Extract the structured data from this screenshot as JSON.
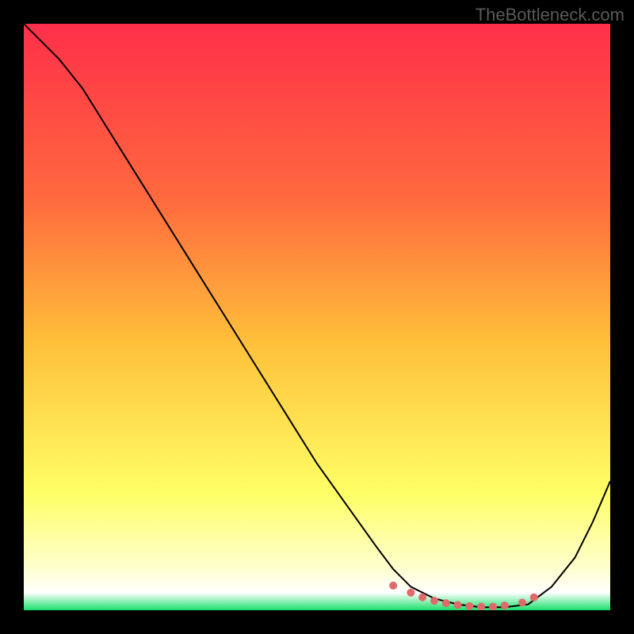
{
  "watermark": "TheBottleneck.com",
  "chart_data": {
    "type": "line",
    "title": "",
    "xlabel": "",
    "ylabel": "",
    "xlim": [
      0,
      100
    ],
    "ylim": [
      0,
      100
    ],
    "grid": false,
    "background_gradient": {
      "stops": [
        {
          "pos": 0.0,
          "color": "#ff2f4a"
        },
        {
          "pos": 0.3,
          "color": "#ff6a3e"
        },
        {
          "pos": 0.55,
          "color": "#ffc23a"
        },
        {
          "pos": 0.8,
          "color": "#ffff66"
        },
        {
          "pos": 0.93,
          "color": "#feffcf"
        },
        {
          "pos": 0.97,
          "color": "#ffffff"
        },
        {
          "pos": 1.0,
          "color": "#18e06a"
        }
      ]
    },
    "series": [
      {
        "name": "bottleneck-curve",
        "color": "#000000",
        "stroke_width": 2,
        "x": [
          0,
          3,
          6,
          10,
          15,
          20,
          25,
          30,
          35,
          40,
          45,
          50,
          55,
          60,
          63,
          66,
          70,
          74,
          78,
          82,
          86,
          90,
          94,
          97,
          100
        ],
        "y": [
          100,
          97,
          94,
          89,
          81,
          73,
          65,
          57,
          49,
          41,
          33,
          25,
          18,
          11,
          7,
          4,
          2,
          1,
          0.5,
          0.5,
          1,
          4,
          9,
          15,
          22
        ]
      }
    ],
    "highlight": {
      "name": "optimal-range",
      "color": "#e06a6a",
      "marker_radius": 5,
      "x": [
        63,
        66,
        68,
        70,
        72,
        74,
        76,
        78,
        80,
        82,
        85,
        87
      ],
      "y": [
        4.2,
        3.0,
        2.2,
        1.6,
        1.2,
        0.9,
        0.7,
        0.6,
        0.6,
        0.8,
        1.3,
        2.2
      ]
    }
  }
}
